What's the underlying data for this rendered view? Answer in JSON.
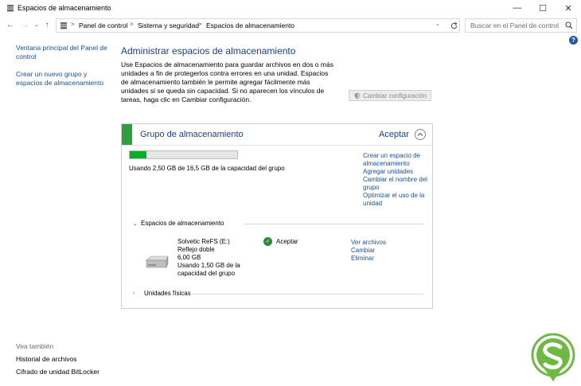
{
  "window": {
    "title": "Espacios de almacenamiento",
    "minimize": "—",
    "maximize": "☐",
    "close": "✕"
  },
  "address": {
    "crumbs": [
      "Panel de control",
      "Sistema y seguridad",
      "Espacios de almacenamiento"
    ],
    "separator": ">",
    "search_placeholder": "Buscar en el Panel de control"
  },
  "help_label": "?",
  "sidebar": {
    "links": [
      "Ventana principal del Panel de control",
      "Crear un nuevo grupo y espacios de almacenamiento"
    ],
    "see_also_title": "Vea también",
    "see_also": [
      "Historial de archivos",
      "Cifrado de unidad BitLocker"
    ]
  },
  "main": {
    "heading": "Administrar espacios de almacenamiento",
    "description": "Use Espacios de almacenamiento para guardar archivos en dos o más unidades a fin de protegerlos contra errores en una unidad. Espacios de almacenamiento también le permite agregar fácilmente más unidades si se queda sin capacidad. Si no aparecen los vínculos de tareas, haga clic en Cambiar configuración.",
    "change_settings_button": "Cambiar configuración"
  },
  "pool": {
    "title": "Grupo de almacenamiento",
    "status": "Aceptar",
    "usage_fraction": 0.152,
    "usage_text": "Usando 2,50 GB de 16,5 GB de la capacidad del grupo",
    "links": [
      "Crear un espacio de almacenamiento",
      "Agregar unidades",
      "Cambiar el nombre del grupo",
      "Optimizar el uso de la unidad"
    ],
    "spaces_section": "Espacios de almacenamiento",
    "space": {
      "name": "Solvetic ReFS (E:)",
      "resiliency": "Reflejo doble",
      "size": "6,00 GB",
      "usage": "Usando 1,50 GB de la capacidad del grupo",
      "status": "Aceptar",
      "links": [
        "Ver archivos",
        "Cambiar",
        "Eliminar"
      ]
    },
    "physical_section": "Unidades físicas"
  },
  "colors": {
    "accent_green": "#2ea043",
    "link_blue": "#1a4f97",
    "heading_blue": "#1a3f8a",
    "bar_fill": "#06b025",
    "logo_green": "#6fb844"
  },
  "icons": {
    "app": "storage-spaces-icon",
    "back": "back-arrow-icon",
    "forward": "forward-arrow-icon",
    "recent": "chevron-down-icon",
    "up": "up-arrow-icon",
    "refresh": "refresh-icon",
    "search": "search-icon",
    "shield": "shield-icon",
    "drive": "hard-drive-icon",
    "ok": "checkmark-icon"
  }
}
